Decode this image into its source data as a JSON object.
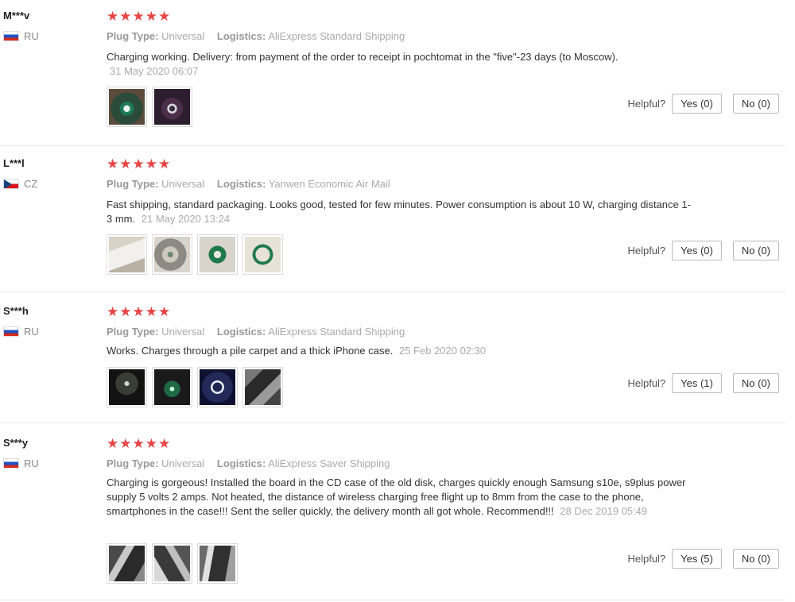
{
  "labels": {
    "plug_type": "Plug Type:",
    "logistics": "Logistics:",
    "helpful": "Helpful?"
  },
  "reviews": [
    {
      "user": "M***v",
      "country": "RU",
      "stars": "★★★★★",
      "plug_type": "Universal",
      "logistics": "AliExpress Standard Shipping",
      "text": "Charging working. Delivery: from payment of the order to receipt in pochtomat in the \"five\"-23 days (to Moscow).",
      "date": "31 May 2020 06:07",
      "yes": "Yes (0)",
      "no": "No (0)",
      "photos": [
        "photo-coil-1",
        "photo-coil-2"
      ]
    },
    {
      "user": "L***l",
      "country": "CZ",
      "stars": "★★★★★",
      "plug_type": "Universal",
      "logistics": "Yanwen Economic Air Mail",
      "text": "Fast shipping, standard packaging. Looks good, tested for few minutes. Power consumption is about 10 W, charging distance 1-3 mm.",
      "date": "21 May 2020 13:24",
      "yes": "Yes (0)",
      "no": "No (0)",
      "photos": [
        "photo-package",
        "photo-board",
        "photo-coil-front",
        "photo-coil-ring"
      ]
    },
    {
      "user": "S***h",
      "country": "RU",
      "stars": "★★★★★",
      "plug_type": "Universal",
      "logistics": "AliExpress Standard Shipping",
      "text": "Works. Charges through a pile carpet and a thick iPhone case.",
      "date": "25 Feb 2020 02:30",
      "yes": "Yes (1)",
      "no": "No (0)",
      "photos": [
        "photo-phone-dark",
        "photo-coil-lit",
        "photo-led-ring",
        "photo-carpet"
      ]
    },
    {
      "user": "S***y",
      "country": "RU",
      "stars": "★★★★★",
      "plug_type": "Universal",
      "logistics": "AliExpress Saver Shipping",
      "text": "Charging is gorgeous! Installed the board in the CD case of the old disk, charges quickly enough Samsung s10e, s9plus power supply 5 volts 2 amps. Not heated, the distance of wireless charging free flight up to 8mm from the case to the phone, smartphones in the case!!! Sent the seller quickly, the delivery month all got whole. Recommend!!!",
      "date": "28 Dec 2019 05:49",
      "yes": "Yes (5)",
      "no": "No (0)",
      "photos": [
        "photo-cd-case-1",
        "photo-cd-case-2",
        "photo-cd-case-3"
      ]
    }
  ]
}
